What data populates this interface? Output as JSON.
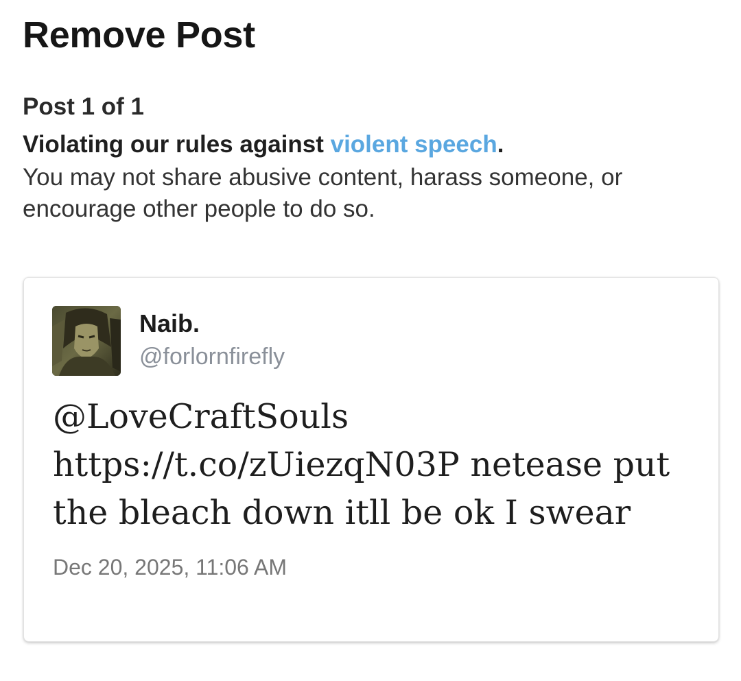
{
  "page": {
    "title": "Remove Post"
  },
  "notice": {
    "post_count": "Post 1 of 1",
    "violation_prefix": "Violating our rules against ",
    "violation_link": "violent speech",
    "violation_suffix": ".",
    "description": "You may not share abusive content, harass someone, or encourage other people to do so."
  },
  "post": {
    "author_name": "Naib.",
    "author_handle": "@forlornfirefly",
    "avatar_icon": "profile-avatar-image",
    "text_lines": [
      "@LoveCraftSouls",
      "https://t.co/zUiezqN03P netease put",
      "the bleach down itll be ok I swear"
    ],
    "timestamp": "Dec 20, 2025, 11:06 AM"
  },
  "colors": {
    "link": "#5aa7e0",
    "handle": "#8a9099",
    "timestamp": "#777777"
  }
}
